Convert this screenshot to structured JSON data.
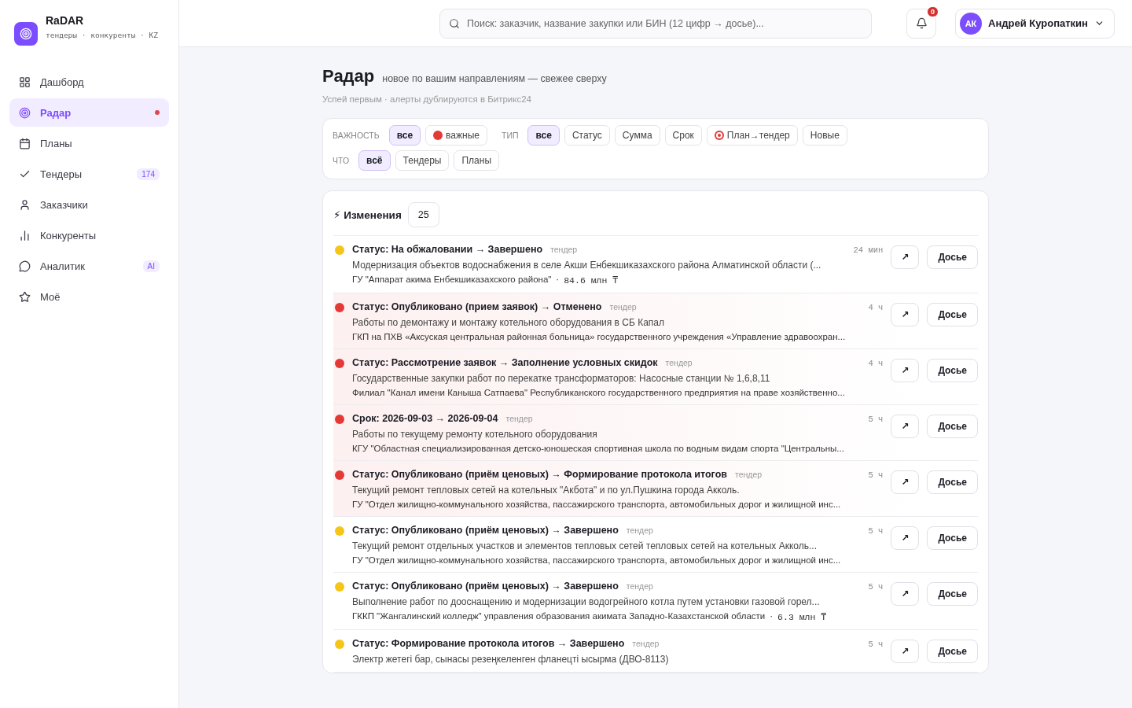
{
  "brand": {
    "name": "RaDAR",
    "tagline": "тендеры · конкуренты · KZ"
  },
  "sidebar": {
    "items": [
      {
        "label": "Дашборд",
        "selected": false
      },
      {
        "label": "Радар",
        "selected": true,
        "alert": true
      },
      {
        "label": "Планы",
        "selected": false
      },
      {
        "label": "Тендеры",
        "selected": false,
        "badge": "174"
      },
      {
        "label": "Заказчики",
        "selected": false
      },
      {
        "label": "Конкуренты",
        "selected": false
      },
      {
        "label": "Аналитик",
        "selected": false,
        "badge": "AI"
      },
      {
        "label": "Моё",
        "selected": false
      }
    ]
  },
  "header": {
    "search": {
      "placeholder": "Поиск: заказчик, название закупки или БИН (12 цифр → досье)..."
    },
    "notifications": {
      "count": "0"
    },
    "user": {
      "initials": "АК",
      "name": "Андрей Куропаткин"
    }
  },
  "page": {
    "title": "Радар",
    "subtitle": "новое по вашим направлениям — свежее сверху",
    "note": "Успей первым · алерты дублируются в Битрикс24"
  },
  "filters": [
    {
      "label": "ВАЖНОСТЬ",
      "chips": [
        {
          "label": "все",
          "selected": true,
          "kind": "plain"
        },
        {
          "label": "важные",
          "selected": false,
          "kind": "dot"
        }
      ]
    },
    {
      "label": "ТИП",
      "chips": [
        {
          "label": "все",
          "selected": true,
          "kind": "plain"
        },
        {
          "label": "Статус",
          "selected": false,
          "kind": "plain"
        },
        {
          "label": "Сумма",
          "selected": false,
          "kind": "plain"
        },
        {
          "label": "Срок",
          "selected": false,
          "kind": "plain"
        },
        {
          "label": "План→тендер",
          "selected": false,
          "kind": "target"
        },
        {
          "label": "Новые",
          "selected": false,
          "kind": "plain"
        }
      ]
    },
    {
      "label": "ЧТО",
      "chips": [
        {
          "label": "всё",
          "selected": true,
          "kind": "plain"
        },
        {
          "label": "Тендеры",
          "selected": false,
          "kind": "plain"
        },
        {
          "label": "Планы",
          "selected": false,
          "kind": "plain"
        }
      ]
    }
  ],
  "changes": {
    "title": "⚡ Изменения",
    "count": "25",
    "rows": [
      {
        "color": "#f5c518",
        "important": false,
        "title": "Статус: На обжаловании → Завершено",
        "type": "тендер",
        "time": "24 мин",
        "description": "Модернизация объектов водоснабжения в селе Акши Енбекшиказахского района Алматинской области (...",
        "customer": "ГУ \"Аппарат акима Енбекшиказахского района\"",
        "separator": "·",
        "amount": "84.6 млн ₸",
        "open_label": "↗",
        "dossier_label": "Досье"
      },
      {
        "color": "#e53935",
        "important": true,
        "title": "Статус: Опубликовано (прием заявок) → Отменено",
        "type": "тендер",
        "time": "4 ч",
        "description": "Работы по демонтажу и монтажу котельного оборудования в СБ Капал",
        "customer": "ГКП на ПХВ «Аксуская центральная районная больница» государственного учреждения «Управление здравоохран...",
        "open_label": "↗",
        "dossier_label": "Досье"
      },
      {
        "color": "#e53935",
        "important": true,
        "title": "Статус: Рассмотрение заявок → Заполнение условных скидок",
        "type": "тендер",
        "time": "4 ч",
        "description": "Государственные закупки работ по перекатке трансформаторов: Насосные станции № 1,6,8,11",
        "customer": "Филиал \"Канал имени Каныша Сатпаева\" Республиканского государственного предприятия на праве хозяйственно...",
        "open_label": "↗",
        "dossier_label": "Досье"
      },
      {
        "color": "#e53935",
        "important": true,
        "title": "Срок: 2026-09-03 → 2026-09-04",
        "type": "тендер",
        "time": "5 ч",
        "description": "Работы по текущему ремонту котельного оборудования",
        "customer": "КГУ \"Областная специализированная детско-юношеская спортивная школа по водным видам спорта \"Центральны...",
        "open_label": "↗",
        "dossier_label": "Досье"
      },
      {
        "color": "#e53935",
        "important": true,
        "title": "Статус: Опубликовано (приём ценовых) → Формирование протокола итогов",
        "type": "тендер",
        "time": "5 ч",
        "description": "Текущий ремонт тепловых сетей на котельных \"Акбота\" и по ул.Пушкина города Акколь.",
        "customer": "ГУ \"Отдел жилищно-коммунального хозяйства, пассажирского транспорта, автомобильных дорог и жилищной инс...",
        "open_label": "↗",
        "dossier_label": "Досье"
      },
      {
        "color": "#f5c518",
        "important": false,
        "title": "Статус: Опубликовано (приём ценовых) → Завершено",
        "type": "тендер",
        "time": "5 ч",
        "description": "Текущий ремонт отдельных участков и элементов тепловых сетей тепловых сетей на котельных Акколь...",
        "customer": "ГУ \"Отдел жилищно-коммунального хозяйства, пассажирского транспорта, автомобильных дорог и жилищной инс...",
        "open_label": "↗",
        "dossier_label": "Досье"
      },
      {
        "color": "#f5c518",
        "important": false,
        "title": "Статус: Опубликовано (приём ценовых) → Завершено",
        "type": "тендер",
        "time": "5 ч",
        "description": "Выполнение работ по дооснащению и модернизации водогрейного котла путем установки газовой горел...",
        "customer": "ГККП \"Жангалинский колледж\" управления образования акимата Западно-Казахстанской области",
        "separator": "·",
        "amount": "6.3 млн ₸",
        "open_label": "↗",
        "dossier_label": "Досье"
      },
      {
        "color": "#f5c518",
        "important": false,
        "title": "Статус: Формирование протокола итогов → Завершено",
        "type": "тендер",
        "time": "5 ч",
        "description": "Электр жетегі бар, сынасы резеңкеленген фланецті ысырма (ДВО-8113)",
        "open_label": "↗",
        "dossier_label": "Досье"
      }
    ]
  }
}
